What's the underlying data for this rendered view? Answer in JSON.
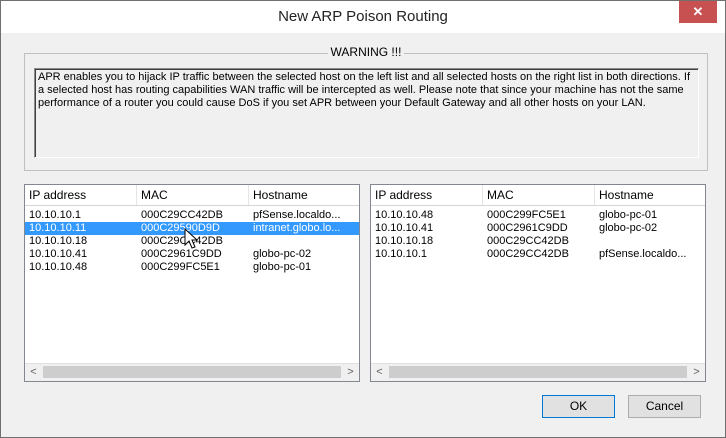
{
  "window": {
    "title": "New ARP Poison Routing",
    "close_label": "✕"
  },
  "warning": {
    "legend": "WARNING !!!",
    "text": "APR enables you to hijack IP traffic between the selected host on the left list and all selected hosts on the right list in both directions. If a selected host has routing capabilities WAN traffic will be intercepted as well. Please note that since your machine has not the same performance of a router you could cause DoS if you set APR between your Default Gateway and all other hosts on your LAN."
  },
  "left_list": {
    "headers": [
      "IP address",
      "MAC",
      "Hostname"
    ],
    "rows": [
      {
        "ip": "10.10.10.1",
        "mac": "000C29CC42DB",
        "host": "pfSense.localdo..."
      },
      {
        "ip": "10.10.10.11",
        "mac": "000C29590D9D",
        "host": "intranet.globo.lo..."
      },
      {
        "ip": "10.10.10.18",
        "mac": "000C29CC42DB",
        "host": ""
      },
      {
        "ip": "10.10.10.41",
        "mac": "000C2961C9DD",
        "host": "globo-pc-02"
      },
      {
        "ip": "10.10.10.48",
        "mac": "000C299FC5E1",
        "host": "globo-pc-01"
      }
    ],
    "selected_index": 1
  },
  "right_list": {
    "headers": [
      "IP address",
      "MAC",
      "Hostname"
    ],
    "rows": [
      {
        "ip": "10.10.10.48",
        "mac": "000C299FC5E1",
        "host": "globo-pc-01"
      },
      {
        "ip": "10.10.10.41",
        "mac": "000C2961C9DD",
        "host": "globo-pc-02"
      },
      {
        "ip": "10.10.10.18",
        "mac": "000C29CC42DB",
        "host": ""
      },
      {
        "ip": "10.10.10.1",
        "mac": "000C29CC42DB",
        "host": "pfSense.localdo..."
      }
    ]
  },
  "scroll": {
    "left_arrow": "<",
    "right_arrow": ">"
  },
  "buttons": {
    "ok": "OK",
    "cancel": "Cancel"
  },
  "colors": {
    "selection": "#3399ff",
    "close": "#c75050"
  }
}
